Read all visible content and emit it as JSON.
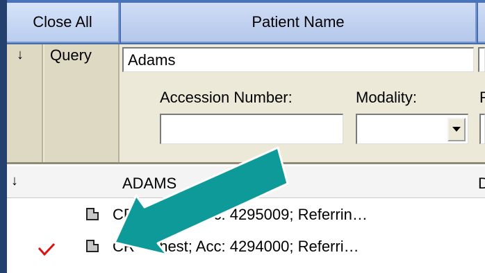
{
  "header": {
    "close_all_label": "Close All",
    "patient_name_label": "Patient Name"
  },
  "query": {
    "sort_arrow": "↓",
    "query_label": "Query",
    "patient_name_value": "Adams",
    "accession_label": "Accession Number:",
    "accession_value": "",
    "modality_label": "Modality:",
    "modality_value": "",
    "partial_label": "R"
  },
  "results": {
    "group_arrow": "↓",
    "group_name": "ADAMS",
    "group_suffix": "D",
    "rows": [
      {
        "text": "CR - Chest; Acc: 4295009;  Referrin…",
        "checked": false,
        "icon": "document-icon"
      },
      {
        "text": "CR - Chest; Acc: 4294000;  Referri…",
        "checked": true,
        "icon": "document-icon"
      }
    ]
  },
  "annotation": {
    "color": "#0f9a9a",
    "icon": "arrow-pointer"
  },
  "colors": {
    "check": "#e01010",
    "background": "#2f5aa3"
  }
}
